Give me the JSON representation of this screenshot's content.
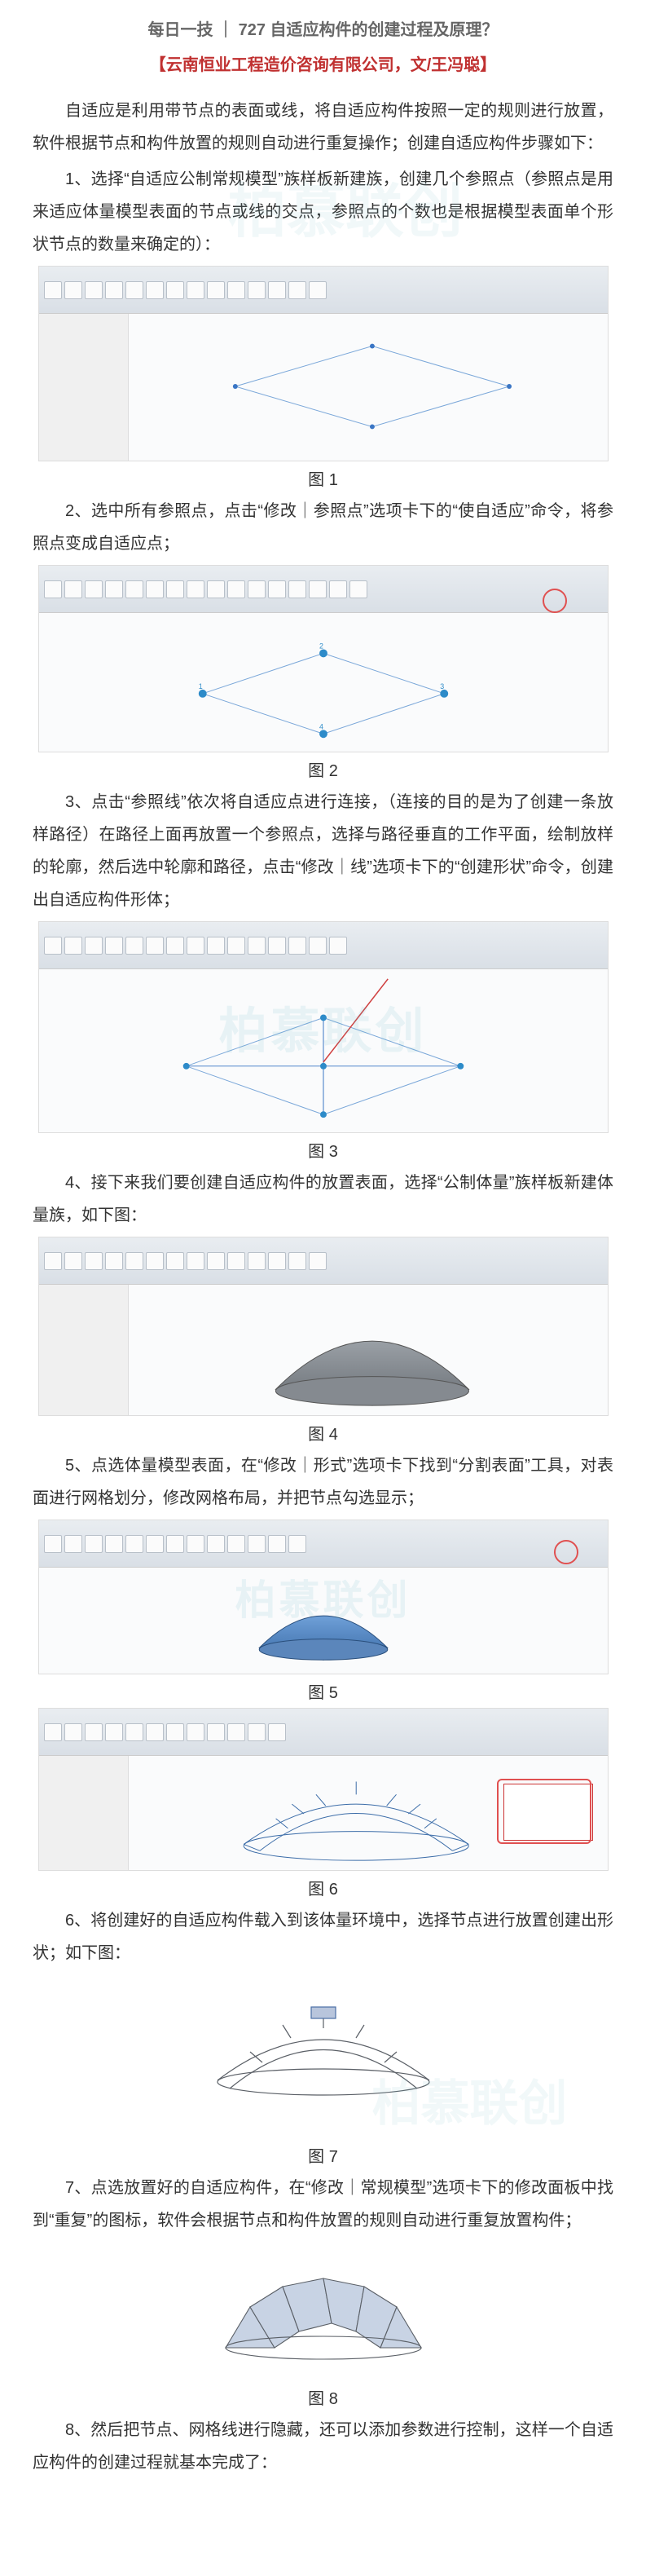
{
  "header": {
    "title": "每日一技 ｜ 727 自适应构件的创建过程及原理？",
    "byline": "【云南恒业工程造价咨询有限公司，文/王冯聪】"
  },
  "intro": "自适应是利用带节点的表面或线，将自适应构件按照一定的规则进行放置，软件根据节点和构件放置的规则自动进行重复操作；创建自适应构件步骤如下：",
  "step1": "1、选择“自适应公制常规模型”族样板新建族，创建几个参照点（参照点是用来适应体量模型表面的节点或线的交点，参照点的个数也是根据模型表面单个形状节点的数量来确定的）：",
  "fig1_caption": "图 1",
  "step2": "2、选中所有参照点，点击“修改｜参照点”选项卡下的“使自适应”命令，将参照点变成自适应点；",
  "fig2_caption": "图 2",
  "step3": "3、点击“参照线”依次将自适应点进行连接，（连接的目的是为了创建一条放样路径）在路径上面再放置一个参照点，选择与路径垂直的工作平面，绘制放样的轮廓，然后选中轮廓和路径，点击“修改｜线”选项卡下的“创建形状”命令，创建出自适应构件形体；",
  "fig3_caption": "图 3",
  "step4": "4、接下来我们要创建自适应构件的放置表面，选择“公制体量”族样板新建体量族，如下图：",
  "fig4_caption": "图 4",
  "step5": "5、点选体量模型表面，在“修改｜形式”选项卡下找到“分割表面”工具，对表面进行网格划分，修改网格布局，并把节点勾选显示；",
  "fig5_caption": "图 5",
  "fig6_caption": "图 6",
  "step6": "6、将创建好的自适应构件载入到该体量环境中，选择节点进行放置创建出形状；如下图：",
  "fig7_caption": "图 7",
  "step7": "7、点选放置好的自适应构件，在“修改｜常规模型”选项卡下的修改面板中找到“重复”的图标，软件会根据节点和构件放置的规则自动进行重复放置构件；",
  "fig8_caption": "图 8",
  "step8": "8、然后把节点、网格线进行隐藏，还可以添加参数进行控制，这样一个自适应构件的创建过程就基本完成了：",
  "watermark_text": "柏慕联创",
  "watermark_icon": "iCB"
}
